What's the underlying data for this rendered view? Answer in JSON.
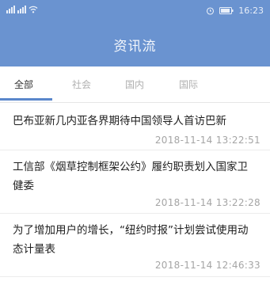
{
  "status_bar": {
    "time": "16:23"
  },
  "header": {
    "title": "资讯流"
  },
  "tabs": [
    {
      "label": "全部"
    },
    {
      "label": "社会"
    },
    {
      "label": "国内"
    },
    {
      "label": "国际"
    }
  ],
  "news": [
    {
      "title": "巴布亚新几内亚各界期待中国领导人首访巴新",
      "time": "2018-11-14 13:22:51"
    },
    {
      "title": "工信部《烟草控制框架公约》履约职责划入国家卫健委",
      "time": "2018-11-14 13:22:28"
    },
    {
      "title": "为了增加用户的增长，“纽约时报”计划尝试使用动态计量表",
      "time": "2018-11-14 12:46:33"
    }
  ]
}
